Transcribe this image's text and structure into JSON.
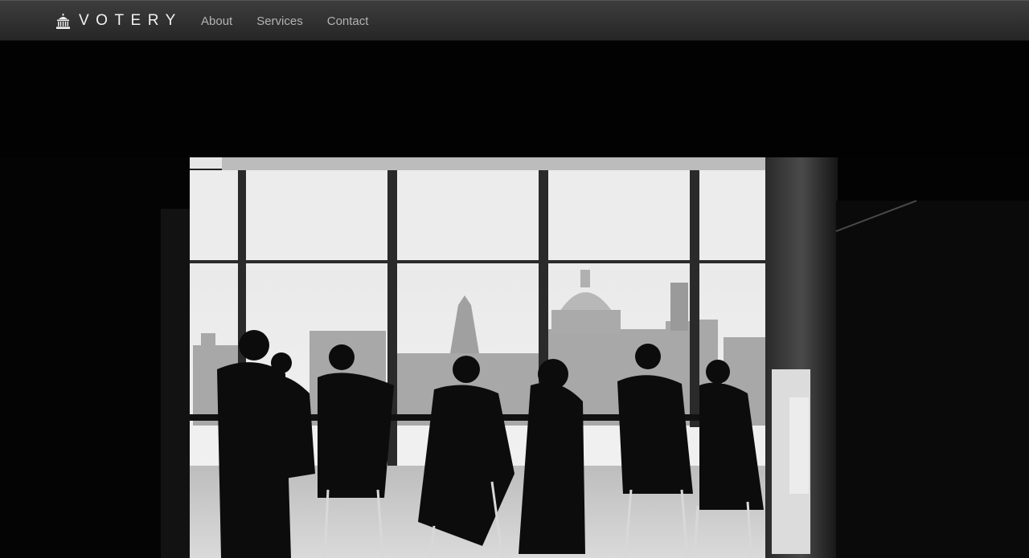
{
  "brand": {
    "name": "VOTERY",
    "icon": "capitol-building-icon"
  },
  "nav": {
    "items": [
      {
        "label": "About"
      },
      {
        "label": "Services"
      },
      {
        "label": "Contact"
      }
    ]
  },
  "colors": {
    "navbar_top": "#3d3d3d",
    "navbar_bottom": "#262626",
    "nav_link": "#b3b3b3",
    "brand_text": "#f2f2f2",
    "hero_background": "#030303"
  }
}
